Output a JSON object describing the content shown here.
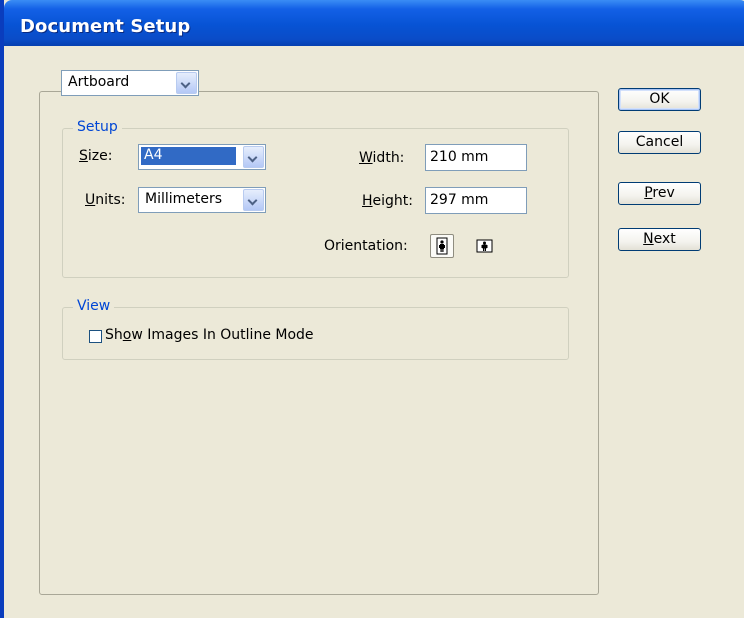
{
  "window": {
    "title": "Document Setup"
  },
  "panel": {
    "selected": "Artboard"
  },
  "setup": {
    "legend": "Setup",
    "size_label_prefix": "",
    "size_label_u": "S",
    "size_label_rest": "ize:",
    "size_value": "A4",
    "units_label_u": "U",
    "units_label_rest": "nits:",
    "units_value": "Millimeters",
    "width_label_u": "W",
    "width_label_rest": "idth:",
    "width_value": "210 mm",
    "height_label_u": "H",
    "height_label_rest": "eight:",
    "height_value": "297 mm",
    "orientation_label": "Orientation:",
    "orientation_selected": "portrait"
  },
  "view": {
    "legend": "View",
    "outline_label_pre": "Sh",
    "outline_label_u": "o",
    "outline_label_post": "w Images In Outline Mode",
    "outline_checked": false
  },
  "buttons": {
    "ok": "OK",
    "cancel": "Cancel",
    "prev_u": "P",
    "prev_rest": "rev",
    "next_u": "N",
    "next_rest": "ext"
  },
  "colors": {
    "title_bar": "#0753d4",
    "dialog_bg": "#ece9d8",
    "legend_text": "#0046d5",
    "selection": "#316ac5"
  }
}
